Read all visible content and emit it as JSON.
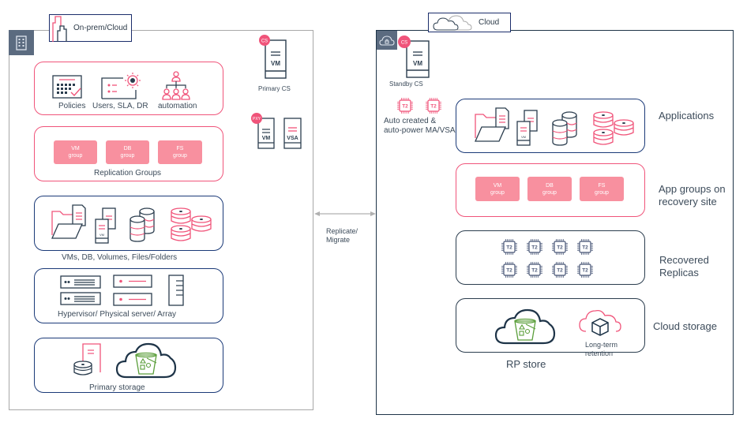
{
  "colors": {
    "accent_pink": "#f0547a",
    "navy": "#1b3a78",
    "dark": "#2b3d4e",
    "group_fill": "#f8909f",
    "green": "#5a9e3a",
    "badge_grey": "#5b6b80"
  },
  "left_site": {
    "title": "On-prem/Cloud",
    "corner_icon": "building-icon",
    "management_group": {
      "items": [
        {
          "icon": "calendar-check-icon",
          "label": "Policies"
        },
        {
          "icon": "settings-panel-icon",
          "label": "Users, SLA, DR"
        },
        {
          "icon": "org-hierarchy-icon",
          "label": "automation"
        }
      ]
    },
    "primary_cs": {
      "badge": "CS",
      "server_label": "VM",
      "caption": "Primary CS"
    },
    "proxy": {
      "badge": "PXY",
      "vm_label": "VM",
      "vsa_label": "VSA"
    },
    "replication_groups": {
      "groups": [
        {
          "line1": "VM",
          "line2": "group"
        },
        {
          "line1": "DB",
          "line2": "group"
        },
        {
          "line1": "FS",
          "line2": "group"
        }
      ],
      "caption": "Replication Groups"
    },
    "workloads": {
      "caption": "VMs, DB, Volumes, Files/Folders",
      "vm_label": "VM"
    },
    "infrastructure": {
      "caption": "Hypervisor/ Physical server/ Array"
    },
    "primary_storage": {
      "caption": "Primary storage"
    }
  },
  "link": {
    "line1": "Replicate/",
    "line2": "Migrate"
  },
  "right_site": {
    "title": "Cloud",
    "corner_icon": "cloud-lock-icon",
    "standby_cs": {
      "badge": "CS",
      "server_label": "VM",
      "caption": "Standby CS"
    },
    "auto_instances": {
      "chip_label": "T2",
      "line1": "Auto created &",
      "line2": "auto-power MA/VSA"
    },
    "applications": {
      "title": "Applications",
      "vm_label": "VM"
    },
    "app_groups": {
      "groups": [
        {
          "line1": "VM",
          "line2": "group"
        },
        {
          "line1": "DB",
          "line2": "group"
        },
        {
          "line1": "FS",
          "line2": "group"
        }
      ],
      "title_line1": "App groups on",
      "title_line2": "recovery site"
    },
    "recovered_replicas": {
      "chip_label": "T2",
      "chip_count": 8,
      "title_line1": "Recovered",
      "title_line2": "Replicas"
    },
    "cloud_storage": {
      "title": "Cloud storage",
      "rp_store": "RP store",
      "ltr_line1": "Long-term",
      "ltr_line2": "retention"
    }
  }
}
